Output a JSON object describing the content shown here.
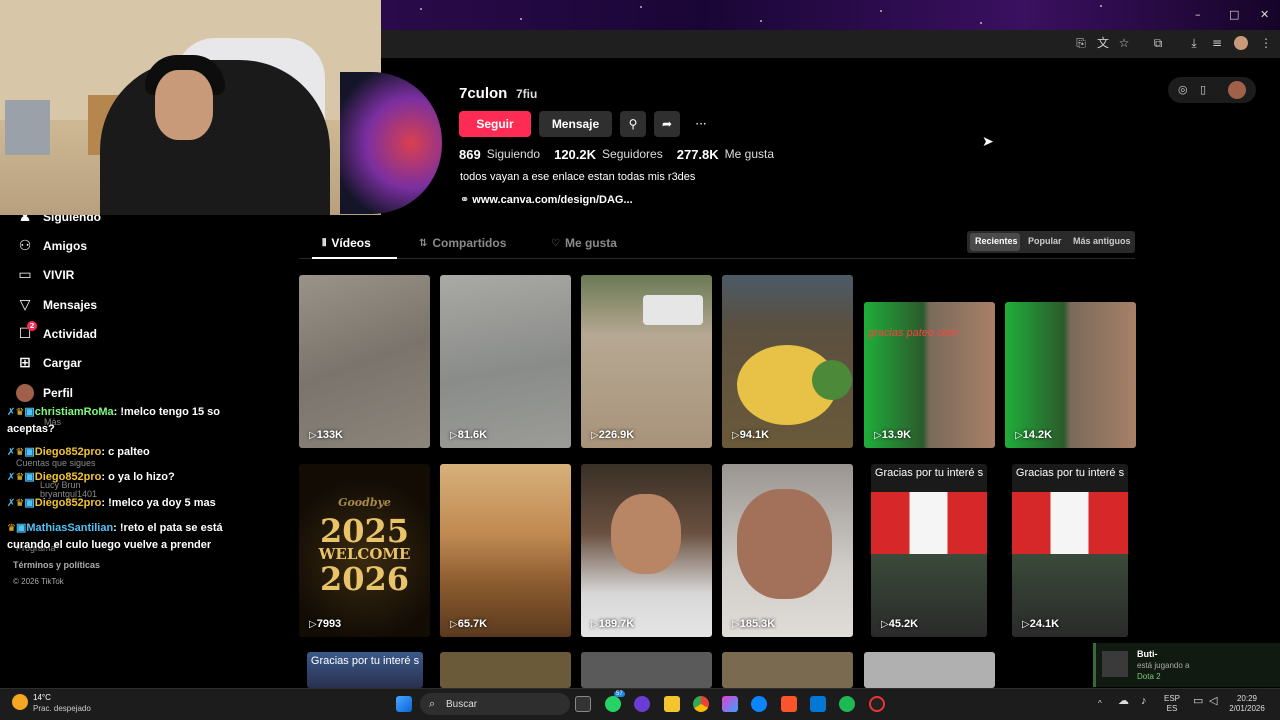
{
  "browser": {
    "window_controls": [
      "–",
      "□",
      "✕"
    ]
  },
  "sidebar": {
    "items": [
      {
        "label": "Siguiendo",
        "icon": "following-icon"
      },
      {
        "label": "Amigos",
        "icon": "friends-icon"
      },
      {
        "label": "VIVIR",
        "icon": "live-icon"
      },
      {
        "label": "Mensajes",
        "icon": "messages-icon"
      },
      {
        "label": "Actividad",
        "icon": "activity-icon",
        "badge": "2"
      },
      {
        "label": "Cargar",
        "icon": "upload-icon"
      },
      {
        "label": "Perfil",
        "icon": "profile-avatar"
      }
    ],
    "more": "Más",
    "following_accounts_title": "Cuentas que sigues",
    "following_account_1": "bryantgul1401",
    "ghost_user": "Lucy Brun",
    "company": "Programa",
    "terms": "Términos y políticas",
    "copyright": "© 2026 TikTok"
  },
  "chat": [
    {
      "user": "christiamRoMa",
      "text": ": !melco tengo 15 so aceptas?",
      "color": "#7CFC7C"
    },
    {
      "user": "Diego852pro",
      "text": ": c palteo",
      "color": "#f4c430"
    },
    {
      "user": "Diego852pro",
      "text": ": o ya lo hizo?",
      "color": "#f4c430"
    },
    {
      "user": "Diego852pro",
      "text": ": !melco ya doy 5 mas",
      "color": "#f4c430"
    },
    {
      "user": "MathiasSantilian",
      "text": ": !reto el pata se está curando el culo luego vuelve a prender",
      "color": "#4fc3f7"
    }
  ],
  "profile": {
    "username": "7culon",
    "handle": "7fiu",
    "follow_label": "Seguir",
    "message_label": "Mensaje",
    "following_count": "869",
    "following_label": "Siguiendo",
    "followers_count": "120.2K",
    "followers_label": "Seguidores",
    "likes_count": "277.8K",
    "likes_label": "Me gusta",
    "bio": "todos vayan a ese enlace estan todas mis r3des",
    "link": "www.canva.com/design/DAG..."
  },
  "tabs": {
    "videos": "Vídeos",
    "shared": "Compartidos",
    "liked": "Me gusta"
  },
  "sort": {
    "recent": "Recientes",
    "popular": "Popular",
    "oldest": "Más antiguos"
  },
  "videos": [
    {
      "views": "133K"
    },
    {
      "views": "81.6K"
    },
    {
      "views": "226.9K"
    },
    {
      "views": "94.1K"
    },
    {
      "views": "13.9K",
      "overlay": "gracias pateo com"
    },
    {
      "views": "14.2K"
    },
    {
      "views": "7993",
      "overlay_top": "Goodbye",
      "overlay_year1": "2025",
      "overlay_mid": "WELCOME",
      "overlay_year2": "2026"
    },
    {
      "views": "65.7K"
    },
    {
      "views": "189.7K"
    },
    {
      "views": "185.3K"
    },
    {
      "views": "45.2K",
      "overlay": "Gracias por tu interé s"
    },
    {
      "views": "24.1K",
      "overlay": "Gracias por tu interé s"
    },
    {
      "views": "",
      "overlay": "Gracias por tu interé s"
    }
  ],
  "notification": {
    "name": "Buti-",
    "status": "está jugando a",
    "game": "Dota 2"
  },
  "taskbar": {
    "temp": "14°C",
    "weather": "Prac. despejado",
    "search_placeholder": "Buscar",
    "lang1": "ESP",
    "lang2": "ES",
    "time": "20:29",
    "date": "2/01/2026",
    "whatsapp_badge": "57"
  }
}
